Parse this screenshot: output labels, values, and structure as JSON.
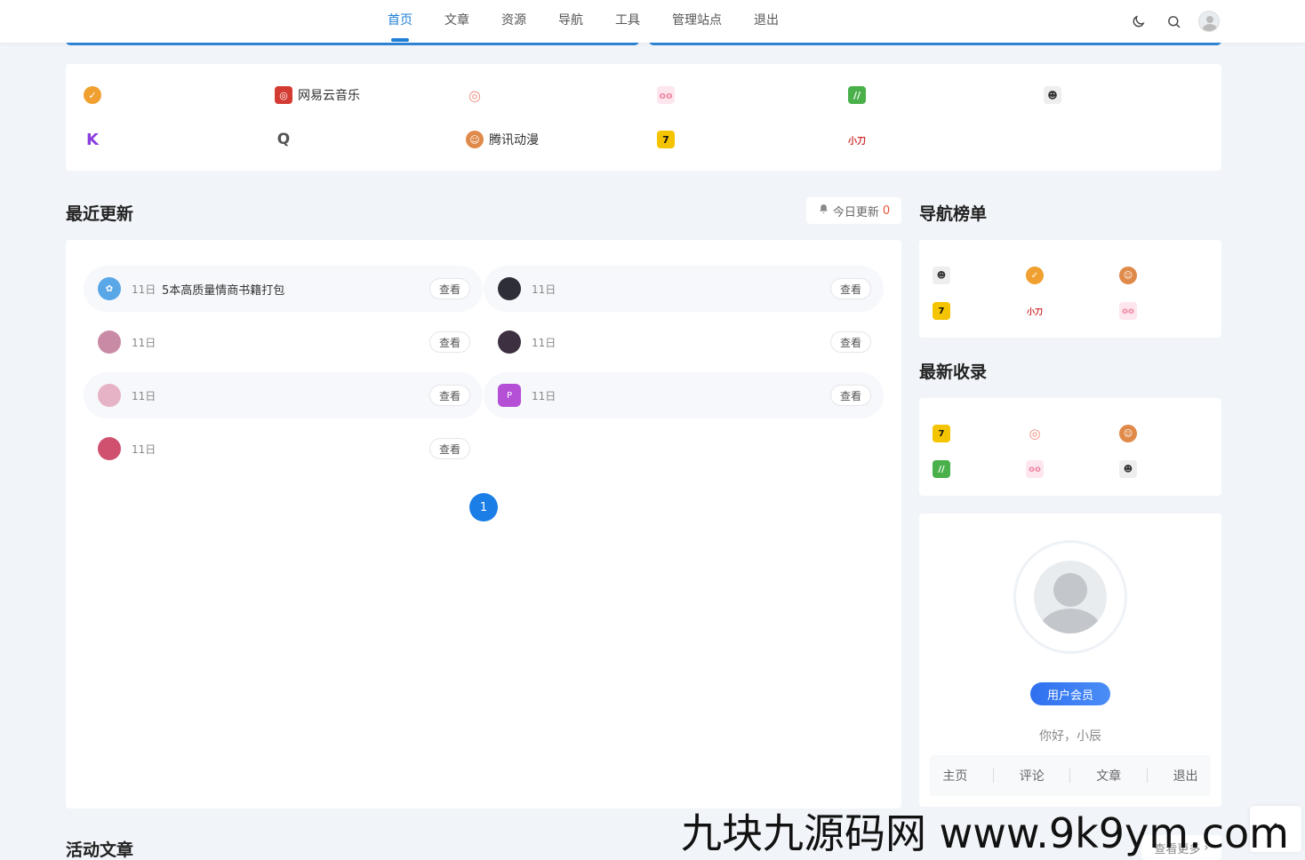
{
  "nav": {
    "items": [
      {
        "label": "首页",
        "active": true
      },
      {
        "label": "文章",
        "active": false
      },
      {
        "label": "资源",
        "active": false
      },
      {
        "label": "导航",
        "active": false
      },
      {
        "label": "工具",
        "active": false
      },
      {
        "label": "管理站点",
        "active": false
      },
      {
        "label": "退出",
        "active": false
      }
    ],
    "icons": [
      "moon-icon",
      "search-icon",
      "avatar"
    ]
  },
  "links": {
    "items": [
      {
        "label": "",
        "icon": "verified-badge-icon",
        "color": "#f0a030"
      },
      {
        "label": "网易云音乐",
        "icon": "netease-music-icon",
        "color": "#d43c33"
      },
      {
        "label": "",
        "icon": "target-icon",
        "color": "#f08a7a"
      },
      {
        "label": "",
        "icon": "pig-icon",
        "color": "#f5b5c5"
      },
      {
        "label": "",
        "icon": "leaf-app-icon",
        "color": "#49b04a"
      },
      {
        "label": "",
        "icon": "ninja-icon",
        "color": "#555555"
      },
      {
        "label": "",
        "icon": "k-letter-icon",
        "color": "#8a3ee0"
      },
      {
        "label": "",
        "icon": "q-letter-icon",
        "color": "#555555"
      },
      {
        "label": "腾讯动漫",
        "icon": "tencent-comic-icon",
        "color": "#e08a4a"
      },
      {
        "label": "",
        "icon": "seven-icon",
        "color": "#f5c400"
      },
      {
        "label": "",
        "icon": "xiaodao-icon",
        "color": "#d23030"
      }
    ]
  },
  "recent": {
    "title": "最近更新",
    "today_label": "今日更新",
    "today_count": "0",
    "view_label": "查看",
    "items": [
      {
        "date": "11日",
        "title": "5本高质量情商书籍打包",
        "color": "#5aa7e8"
      },
      {
        "date": "11日",
        "title": "",
        "color": "#2e2e38"
      },
      {
        "date": "11日",
        "title": "",
        "color": "#c98aa5"
      },
      {
        "date": "11日",
        "title": "",
        "color": "#3d3040"
      },
      {
        "date": "11日",
        "title": "",
        "color": "#e6b3c6"
      },
      {
        "date": "11日",
        "title": "",
        "color": "#b44fd6"
      },
      {
        "date": "11日",
        "title": "",
        "color": "#d05070"
      }
    ],
    "page": "1"
  },
  "sidebar": {
    "rank_title": "导航榜单",
    "latest_title": "最新收录",
    "rank_icons": [
      {
        "icon": "ninja-icon",
        "color": "#555555"
      },
      {
        "icon": "verified-badge-icon",
        "color": "#f0a030"
      },
      {
        "icon": "tencent-comic-icon",
        "color": "#e08a4a"
      },
      {
        "icon": "seven-icon",
        "color": "#f5c400"
      },
      {
        "icon": "xiaodao-icon",
        "color": "#d23030"
      },
      {
        "icon": "pig-icon",
        "color": "#f5b5c5"
      }
    ],
    "latest_icons": [
      {
        "icon": "seven-icon",
        "color": "#f5c400"
      },
      {
        "icon": "target-icon",
        "color": "#f08a7a"
      },
      {
        "icon": "tencent-comic-icon",
        "color": "#e08a4a"
      },
      {
        "icon": "leaf-app-icon",
        "color": "#49b04a"
      },
      {
        "icon": "pig-icon",
        "color": "#f5b5c5"
      },
      {
        "icon": "ninja-icon",
        "color": "#555555"
      }
    ]
  },
  "user": {
    "badge": "用户会员",
    "greeting": "你好，小辰",
    "menu": [
      "主页",
      "评论",
      "文章",
      "退出"
    ]
  },
  "bottom": {
    "activity_title": "活动文章",
    "more_label": "查看更多"
  },
  "watermark": "九块九源码网 www.9k9ym.com",
  "colors": {
    "accent": "#1f7fd6",
    "page_bg": "#f1f4f8",
    "pagination": "#1a7ee6",
    "today_count": "#e2573a"
  }
}
